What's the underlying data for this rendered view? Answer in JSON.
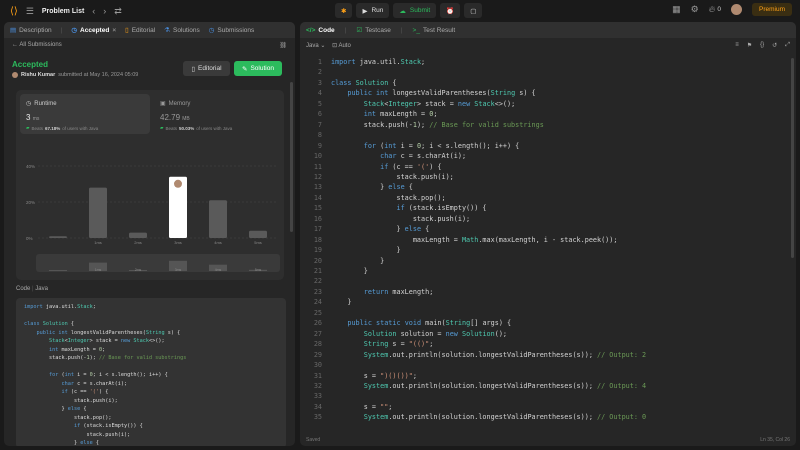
{
  "topbar": {
    "title": "Problem List",
    "run_label": "Run",
    "submit_label": "Submit",
    "streak": "0",
    "premium_label": "Premium"
  },
  "left_tabs": [
    {
      "label": "Description"
    },
    {
      "label": "Accepted"
    },
    {
      "label": "Editorial"
    },
    {
      "label": "Solutions"
    },
    {
      "label": "Submissions"
    }
  ],
  "submission": {
    "back_label": "All Submissions",
    "status": "Accepted",
    "author": "Rishu Kumar",
    "submitted_text": "submitted at May 16, 2024 05:09",
    "editorial_label": "Editorial",
    "solution_label": "Solution"
  },
  "runtime": {
    "label": "Runtime",
    "value": "3",
    "unit": "ms",
    "beats_prefix": "Beats",
    "beats_value": "67.18%",
    "beats_suffix": "of users with Java"
  },
  "memory": {
    "label": "Memory",
    "value": "42.79",
    "unit": "MB",
    "beats_prefix": "Beats",
    "beats_value": "50.03%",
    "beats_suffix": "of users with Java"
  },
  "chart_data": {
    "type": "bar",
    "y_ticks": [
      "40%",
      "20%",
      "0%"
    ],
    "ylim": [
      0,
      40
    ],
    "categories": [
      "",
      "1ms",
      "2ms",
      "3ms",
      "4ms",
      "5ms"
    ],
    "values": [
      1,
      28,
      3,
      34,
      21,
      4
    ],
    "highlight_index": 3
  },
  "code_panel": {
    "title": "Code",
    "lang": "Java",
    "lines": [
      "import java.util.Stack;",
      "",
      "class Solution {",
      "    public int longestValidParentheses(String s) {",
      "        Stack<Integer> stack = new Stack<>();",
      "        int maxLength = 0;",
      "        stack.push(-1); // Base for valid substrings",
      "",
      "        for (int i = 0; i < s.length(); i++) {",
      "            char c = s.charAt(i);",
      "            if (c == '(') {",
      "                stack.push(i);",
      "            } else {",
      "                stack.pop();",
      "                if (stack.isEmpty()) {",
      "                    stack.push(i);",
      "                } else {",
      "                    maxLength = Math.max(maxLength, i - stack.peek());"
    ]
  },
  "right_tabs": [
    {
      "label": "Code"
    },
    {
      "label": "Testcase"
    },
    {
      "label": "Test Result"
    }
  ],
  "editor": {
    "language": "Java",
    "mode": "Auto",
    "saved": "Saved",
    "position": "Ln 35, Col 26",
    "lines": [
      {
        "n": "1",
        "t": "import java.util.Stack;"
      },
      {
        "n": "2",
        "t": ""
      },
      {
        "n": "3",
        "t": "class Solution {"
      },
      {
        "n": "4",
        "t": "    public int longestValidParentheses(String s) {"
      },
      {
        "n": "5",
        "t": "        Stack<Integer> stack = new Stack<>();"
      },
      {
        "n": "6",
        "t": "        int maxLength = 0;"
      },
      {
        "n": "7",
        "t": "        stack.push(-1); // Base for valid substrings"
      },
      {
        "n": "8",
        "t": ""
      },
      {
        "n": "9",
        "t": "        for (int i = 0; i < s.length(); i++) {"
      },
      {
        "n": "10",
        "t": "            char c = s.charAt(i);"
      },
      {
        "n": "11",
        "t": "            if (c == '(') {"
      },
      {
        "n": "12",
        "t": "                stack.push(i);"
      },
      {
        "n": "13",
        "t": "            } else {"
      },
      {
        "n": "14",
        "t": "                stack.pop();"
      },
      {
        "n": "15",
        "t": "                if (stack.isEmpty()) {"
      },
      {
        "n": "16",
        "t": "                    stack.push(i);"
      },
      {
        "n": "17",
        "t": "                } else {"
      },
      {
        "n": "18",
        "t": "                    maxLength = Math.max(maxLength, i - stack.peek());"
      },
      {
        "n": "19",
        "t": "                }"
      },
      {
        "n": "20",
        "t": "            }"
      },
      {
        "n": "21",
        "t": "        }"
      },
      {
        "n": "22",
        "t": ""
      },
      {
        "n": "23",
        "t": "        return maxLength;"
      },
      {
        "n": "24",
        "t": "    }"
      },
      {
        "n": "25",
        "t": ""
      },
      {
        "n": "26",
        "t": "    public static void main(String[] args) {"
      },
      {
        "n": "27",
        "t": "        Solution solution = new Solution();"
      },
      {
        "n": "28",
        "t": "        String s = \"(()\";"
      },
      {
        "n": "29",
        "t": "        System.out.println(solution.longestValidParentheses(s)); // Output: 2"
      },
      {
        "n": "30",
        "t": ""
      },
      {
        "n": "31",
        "t": "        s = \")()())\";"
      },
      {
        "n": "32",
        "t": "        System.out.println(solution.longestValidParentheses(s)); // Output: 4"
      },
      {
        "n": "33",
        "t": ""
      },
      {
        "n": "34",
        "t": "        s = \"\";"
      },
      {
        "n": "35",
        "t": "        System.out.println(solution.longestValidParentheses(s)); // Output: 0"
      }
    ]
  },
  "colors": {
    "accent_green": "#2cbb5d",
    "premium": "#ffa116",
    "highlight_bar": "#ffffff",
    "bar": "#5a5a5a"
  }
}
